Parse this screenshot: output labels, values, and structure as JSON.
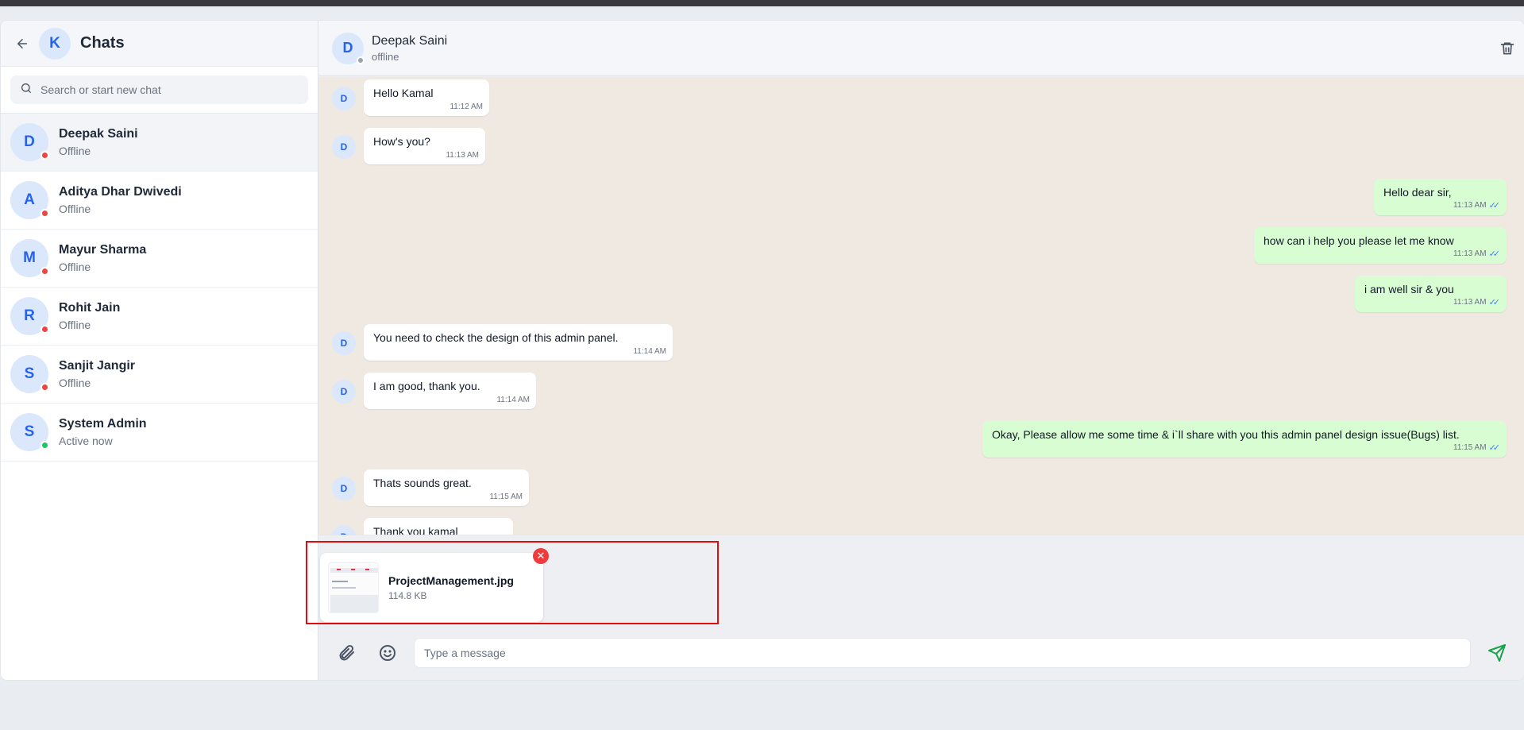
{
  "colors": {
    "accent": "#2563eb",
    "avatar_bg": "#dbe7fb",
    "offline_dot": "#ef4444",
    "online_dot": "#22c55e",
    "outgoing_bubble": "#d9fdd3",
    "incoming_bubble": "#ffffff",
    "chat_bg": "#efe9e2",
    "highlight_frame": "#e10d0d"
  },
  "icons": {
    "back": "arrow-left-icon",
    "search": "search-icon",
    "delete": "trash-icon",
    "attach": "paperclip-icon",
    "emoji": "smiley-icon",
    "send": "send-icon",
    "remove": "close-icon",
    "read": "double-check-icon"
  },
  "sidebar": {
    "user_initial": "K",
    "title": "Chats",
    "search_placeholder": "Search or start new chat",
    "contacts": [
      {
        "initial": "D",
        "name": "Deepak Saini",
        "status": "Offline",
        "online": false,
        "active": true
      },
      {
        "initial": "A",
        "name": "Aditya Dhar Dwivedi",
        "status": "Offline",
        "online": false,
        "active": false
      },
      {
        "initial": "M",
        "name": "Mayur Sharma",
        "status": "Offline",
        "online": false,
        "active": false
      },
      {
        "initial": "R",
        "name": "Rohit Jain",
        "status": "Offline",
        "online": false,
        "active": false
      },
      {
        "initial": "S",
        "name": "Sanjit Jangir",
        "status": "Offline",
        "online": false,
        "active": false
      },
      {
        "initial": "S",
        "name": "System Admin",
        "status": "Active now",
        "online": true,
        "active": false
      }
    ]
  },
  "conversation": {
    "contact_initial": "D",
    "contact_name": "Deepak Saini",
    "contact_status": "offline",
    "messages": [
      {
        "dir": "in",
        "avatar": "D",
        "text": "Hello Kamal",
        "time": "11:12 AM"
      },
      {
        "dir": "in",
        "avatar": "D",
        "text": "How's you?",
        "time": "11:13 AM"
      },
      {
        "dir": "out",
        "text": "Hello dear sir,",
        "time": "11:13 AM"
      },
      {
        "dir": "out",
        "text": "how can i help you please let me know",
        "time": "11:13 AM"
      },
      {
        "dir": "out",
        "text": "i am well sir & you",
        "time": "11:13 AM"
      },
      {
        "dir": "in",
        "avatar": "D",
        "text": "You need to check the design of this admin panel.",
        "time": "11:14 AM"
      },
      {
        "dir": "in",
        "avatar": "D",
        "text": "I am good, thank you.",
        "time": "11:14 AM"
      },
      {
        "dir": "out",
        "text": "Okay, Please allow me some time & i`ll share with you this admin panel design issue(Bugs) list.",
        "time": "11:15 AM"
      },
      {
        "dir": "in",
        "avatar": "D",
        "text": "Thats sounds great.",
        "time": "11:15 AM"
      },
      {
        "dir": "in",
        "avatar": "D",
        "text": "Thank you kamal",
        "time": ""
      }
    ]
  },
  "attachment": {
    "file_name": "ProjectManagement.jpg",
    "file_size": "114.8 KB"
  },
  "composer": {
    "placeholder": "Type a message"
  }
}
